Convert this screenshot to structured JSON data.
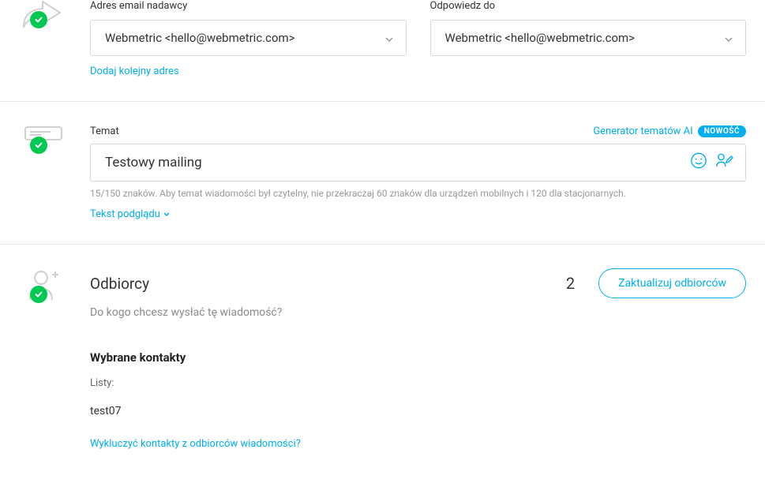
{
  "sender": {
    "label": "Adres email nadawcy",
    "value": "Webmetric <hello@webmetric.com>",
    "add_link": "Dodaj kolejny adres"
  },
  "reply_to": {
    "label": "Odpowiedz do",
    "value": "Webmetric <hello@webmetric.com>"
  },
  "subject": {
    "label": "Temat",
    "value": "Testowy mailing",
    "hint": "15/150 znaków. Aby temat wiadomości był czytelny, nie przekraczaj 60 znaków dla urządzeń mobilnych i 120 dla stacjonarnych.",
    "preview_link": "Tekst podglądu",
    "ai_link": "Generator tematów AI",
    "badge": "NOWOŚĆ"
  },
  "recipients": {
    "heading": "Odbiorcy",
    "subheading": "Do kogo chcesz wysłać tę wiadomość?",
    "count": "2",
    "update_btn": "Zaktualizuj odbiorców",
    "selected_label": "Wybrane kontakty",
    "lists_label": "Listy:",
    "list_name": "test07",
    "exclude_link": "Wykluczyć kontakty z odbiorców wiadomości?"
  }
}
